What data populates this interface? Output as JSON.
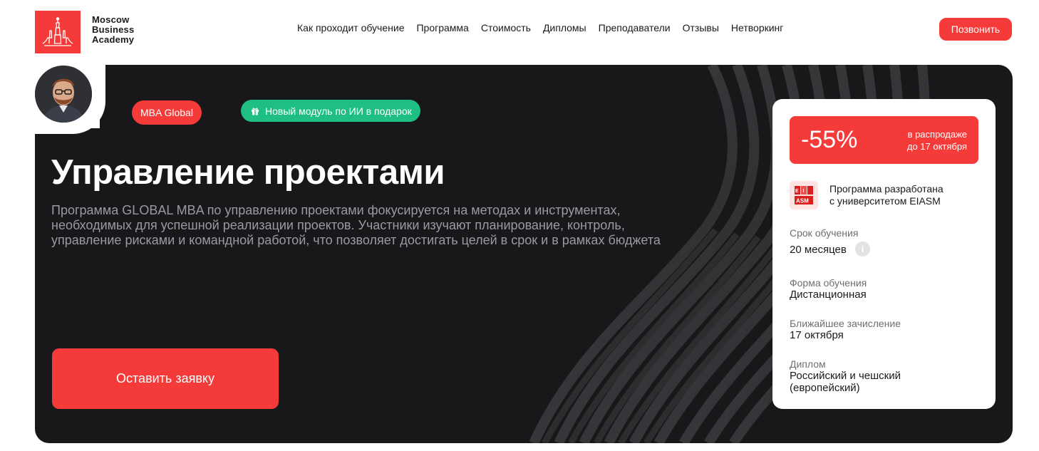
{
  "brand": {
    "name_line1": "Moscow",
    "name_line2": "Business",
    "name_line3": "Academy",
    "accent_color": "#f53b39",
    "green_color": "#1fbf84"
  },
  "nav": {
    "items": [
      {
        "label": "Как проходит обучение"
      },
      {
        "label": "Программа"
      },
      {
        "label": "Стоимость"
      },
      {
        "label": "Дипломы"
      },
      {
        "label": "Преподаватели"
      },
      {
        "label": "Отзывы"
      },
      {
        "label": "Нетворкинг"
      }
    ],
    "call_button": "Позвонить"
  },
  "hero": {
    "badge_program": "MBA Global",
    "badge_gift": "Новый модуль по ИИ в подарок",
    "badge_gift_icon": "gift-icon",
    "title": "Управление проектами",
    "description": "Программа GLOBAL MBA по управлению проектами фокусируется на методах и инструментах, необходимых для успешной реализации проектов. Участники изучают планирование, контроль, управление рисками и командной работой, что позволяет достигать целей в срок и в рамках бюджета",
    "apply_button": "Оставить заявку"
  },
  "card": {
    "sale_percent": "-55%",
    "sale_note_line1": "в распродаже",
    "sale_note_line2": "до 17 октября",
    "partner_logo": "EIASM",
    "partner_line1": "Программа разработана",
    "partner_line2": "с университетом EIASM",
    "duration_label": "Срок обучения",
    "duration_value": "20 месяцев",
    "info_icon": "i",
    "form_label": "Форма обучения",
    "form_value": "Дистанционная",
    "enroll_label": "Ближайшее зачисление",
    "enroll_value": "17 октября",
    "diploma_label": "Диплом",
    "diploma_value_line1": "Российский и чешский",
    "diploma_value_line2": "(европейский)"
  }
}
